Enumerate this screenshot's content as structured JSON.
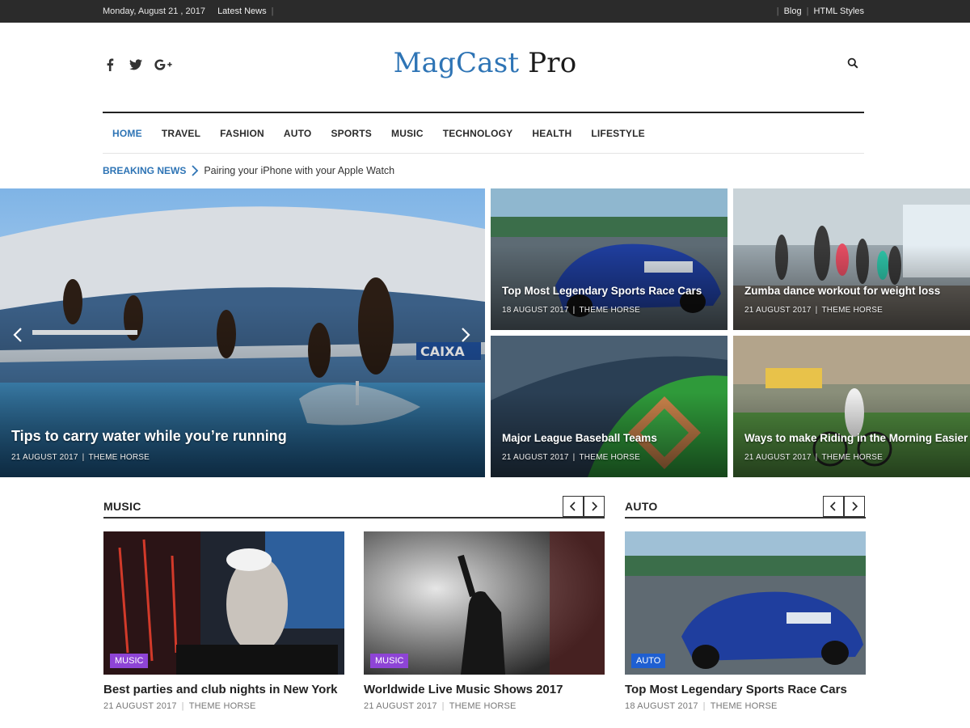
{
  "topbar": {
    "date": "Monday, August 21 , 2017",
    "latest": "Latest News",
    "links": [
      "Blog",
      "HTML Styles"
    ]
  },
  "logo": {
    "part1": "MagCast",
    "part2": "Pro"
  },
  "nav": {
    "items": [
      "HOME",
      "TRAVEL",
      "FASHION",
      "AUTO",
      "SPORTS",
      "MUSIC",
      "TECHNOLOGY",
      "HEALTH",
      "LIFESTYLE"
    ],
    "active": "HOME"
  },
  "breaking": {
    "label": "BREAKING NEWS",
    "text": "Pairing your iPhone with your Apple Watch"
  },
  "hero": {
    "main": {
      "title": "Tips to carry water while you’re running",
      "date": "21 AUGUST 2017",
      "author": "THEME HORSE"
    },
    "tiles": [
      {
        "title": "Top Most Legendary Sports Race Cars",
        "date": "18 AUGUST 2017",
        "author": "THEME HORSE"
      },
      {
        "title": "Zumba dance workout for weight loss",
        "date": "21 AUGUST 2017",
        "author": "THEME HORSE"
      },
      {
        "title": "Major League Baseball Teams",
        "date": "21 AUGUST 2017",
        "author": "THEME HORSE"
      },
      {
        "title": "Ways to make Riding in the Morning Easier",
        "date": "21 AUGUST 2017",
        "author": "THEME HORSE"
      }
    ]
  },
  "sections": {
    "music": {
      "title": "MUSIC",
      "cards": [
        {
          "badge": "MUSIC",
          "title": "Best parties and club nights in New York",
          "date": "21 AUGUST 2017",
          "author": "THEME HORSE"
        },
        {
          "badge": "MUSIC",
          "title": "Worldwide Live Music Shows 2017",
          "date": "21 AUGUST 2017",
          "author": "THEME HORSE"
        }
      ]
    },
    "auto": {
      "title": "AUTO",
      "cards": [
        {
          "badge": "AUTO",
          "title": "Top Most Legendary Sports Race Cars",
          "date": "18 AUGUST 2017",
          "author": "THEME HORSE"
        }
      ]
    }
  },
  "colors": {
    "accent": "#2e74b5",
    "music_badge": "#8e44d6",
    "auto_badge": "#1f5fd1",
    "topbar": "#2b2b2b"
  },
  "icons": [
    "facebook-icon",
    "twitter-icon",
    "google-plus-icon",
    "search-icon",
    "chevron-right-icon",
    "chevron-left-icon"
  ]
}
